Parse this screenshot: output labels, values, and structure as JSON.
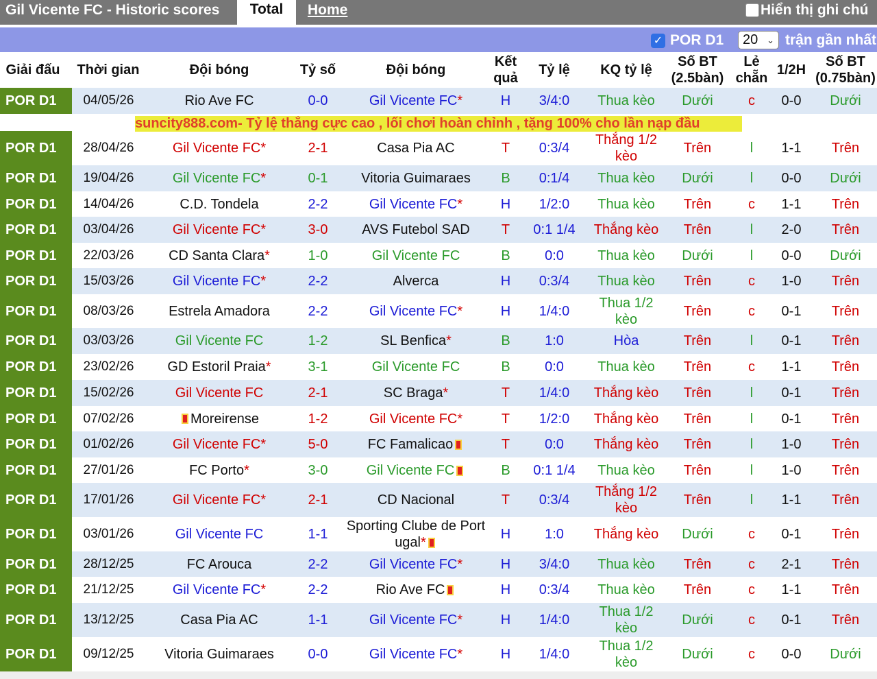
{
  "header": {
    "title": "Gil Vicente FC - Historic scores",
    "tab_total": "Total",
    "tab_home": "Home",
    "show_notes_label": "Hiển thị ghi chú"
  },
  "filter": {
    "league": "POR D1",
    "count": "20",
    "suffix": "trận gần nhất"
  },
  "columns": {
    "league": "Giải đấu",
    "time": "Thời gian",
    "home": "Đội bóng",
    "score": "Tỷ số",
    "away": "Đội bóng",
    "result": "Kết quả",
    "odds": "Tỷ lệ",
    "odds_result": "KQ tỷ lệ",
    "goals25": "Số BT (2.5bàn)",
    "oddeven": "Lẻ chẵn",
    "half": "1/2H",
    "goals075": "Số BT (0.75bàn)"
  },
  "ad_text": "suncity888.com- Tỷ lệ thắng cực cao , lối chơi hoàn chỉnh , tặng 100% cho lần nạp đầu",
  "colors": {
    "league_bg": "#5a8b1e",
    "row_alt": "#dde8f5",
    "win": "#d00000",
    "draw": "#1b1bd6",
    "loss": "#2a9a2a",
    "ad_bg": "#ecec3a",
    "ad_text": "#e0402a"
  },
  "matches": [
    {
      "league": "POR D1",
      "date": "04/05/26",
      "home": "Rio Ave FC",
      "home_star": "",
      "home_card": "",
      "home_card_before": "",
      "score_h": "0",
      "score_a": "0",
      "away": "Gil Vicente FC",
      "away_star": "*",
      "away_card": "",
      "result": "H",
      "odds": "3/4:0",
      "odds_result": "Thua kèo",
      "ou": "Dưới",
      "oe": "c",
      "half": "0-0",
      "ou2": "Dưới"
    },
    {
      "league": "POR D1",
      "date": "28/04/26",
      "home": "Gil Vicente FC",
      "home_star": "*",
      "home_card": "",
      "home_card_before": "",
      "score_h": "2",
      "score_a": "1",
      "away": "Casa Pia AC",
      "away_star": "",
      "away_card": "",
      "result": "T",
      "odds": "0:3/4",
      "odds_result": "Thắng 1/2 kèo",
      "ou": "Trên",
      "oe": "l",
      "half": "1-1",
      "ou2": "Trên"
    },
    {
      "league": "POR D1",
      "date": "19/04/26",
      "home": "Gil Vicente FC",
      "home_star": "*",
      "home_card": "",
      "home_card_before": "",
      "score_h": "0",
      "score_a": "1",
      "away": "Vitoria Guimaraes",
      "away_star": "",
      "away_card": "",
      "result": "B",
      "odds": "0:1/4",
      "odds_result": "Thua kèo",
      "ou": "Dưới",
      "oe": "l",
      "half": "0-0",
      "ou2": "Dưới"
    },
    {
      "league": "POR D1",
      "date": "14/04/26",
      "home": "C.D. Tondela",
      "home_star": "",
      "home_card": "",
      "home_card_before": "",
      "score_h": "2",
      "score_a": "2",
      "away": "Gil Vicente FC",
      "away_star": "*",
      "away_card": "",
      "result": "H",
      "odds": "1/2:0",
      "odds_result": "Thua kèo",
      "ou": "Trên",
      "oe": "c",
      "half": "1-1",
      "ou2": "Trên"
    },
    {
      "league": "POR D1",
      "date": "03/04/26",
      "home": "Gil Vicente FC",
      "home_star": "*",
      "home_card": "",
      "home_card_before": "",
      "score_h": "3",
      "score_a": "0",
      "away": "AVS Futebol SAD",
      "away_star": "",
      "away_card": "",
      "result": "T",
      "odds": "0:1 1/4",
      "odds_result": "Thắng kèo",
      "ou": "Trên",
      "oe": "l",
      "half": "2-0",
      "ou2": "Trên"
    },
    {
      "league": "POR D1",
      "date": "22/03/26",
      "home": "CD Santa Clara",
      "home_star": "*",
      "home_card": "",
      "home_card_before": "",
      "score_h": "1",
      "score_a": "0",
      "away": "Gil Vicente FC",
      "away_star": "",
      "away_card": "",
      "result": "B",
      "odds": "0:0",
      "odds_result": "Thua kèo",
      "ou": "Dưới",
      "oe": "l",
      "half": "0-0",
      "ou2": "Dưới"
    },
    {
      "league": "POR D1",
      "date": "15/03/26",
      "home": "Gil Vicente FC",
      "home_star": "*",
      "home_card": "",
      "home_card_before": "",
      "score_h": "2",
      "score_a": "2",
      "away": "Alverca",
      "away_star": "",
      "away_card": "",
      "result": "H",
      "odds": "0:3/4",
      "odds_result": "Thua kèo",
      "ou": "Trên",
      "oe": "c",
      "half": "1-0",
      "ou2": "Trên"
    },
    {
      "league": "POR D1",
      "date": "08/03/26",
      "home": "Estrela Amadora",
      "home_star": "",
      "home_card": "",
      "home_card_before": "",
      "score_h": "2",
      "score_a": "2",
      "away": "Gil Vicente FC",
      "away_star": "*",
      "away_card": "",
      "result": "H",
      "odds": "1/4:0",
      "odds_result": "Thua 1/2 kèo",
      "ou": "Trên",
      "oe": "c",
      "half": "0-1",
      "ou2": "Trên"
    },
    {
      "league": "POR D1",
      "date": "03/03/26",
      "home": "Gil Vicente FC",
      "home_star": "",
      "home_card": "",
      "home_card_before": "",
      "score_h": "1",
      "score_a": "2",
      "away": "SL Benfica",
      "away_star": "*",
      "away_card": "",
      "result": "B",
      "odds": "1:0",
      "odds_result": "Hòa",
      "ou": "Trên",
      "oe": "l",
      "half": "0-1",
      "ou2": "Trên"
    },
    {
      "league": "POR D1",
      "date": "23/02/26",
      "home": "GD Estoril Praia",
      "home_star": "*",
      "home_card": "",
      "home_card_before": "",
      "score_h": "3",
      "score_a": "1",
      "away": "Gil Vicente FC",
      "away_star": "",
      "away_card": "",
      "result": "B",
      "odds": "0:0",
      "odds_result": "Thua kèo",
      "ou": "Trên",
      "oe": "c",
      "half": "1-1",
      "ou2": "Trên"
    },
    {
      "league": "POR D1",
      "date": "15/02/26",
      "home": "Gil Vicente FC",
      "home_star": "",
      "home_card": "",
      "home_card_before": "",
      "score_h": "2",
      "score_a": "1",
      "away": "SC Braga",
      "away_star": "*",
      "away_card": "",
      "result": "T",
      "odds": "1/4:0",
      "odds_result": "Thắng kèo",
      "ou": "Trên",
      "oe": "l",
      "half": "0-1",
      "ou2": "Trên"
    },
    {
      "league": "POR D1",
      "date": "07/02/26",
      "home": "Moreirense",
      "home_star": "",
      "home_card": "",
      "home_card_before": "1",
      "score_h": "1",
      "score_a": "2",
      "away": "Gil Vicente FC",
      "away_star": "*",
      "away_card": "",
      "result": "T",
      "odds": "1/2:0",
      "odds_result": "Thắng kèo",
      "ou": "Trên",
      "oe": "l",
      "half": "0-1",
      "ou2": "Trên"
    },
    {
      "league": "POR D1",
      "date": "01/02/26",
      "home": "Gil Vicente FC",
      "home_star": "*",
      "home_card": "",
      "home_card_before": "",
      "score_h": "5",
      "score_a": "0",
      "away": "FC Famalicao",
      "away_star": "",
      "away_card": "1",
      "result": "T",
      "odds": "0:0",
      "odds_result": "Thắng kèo",
      "ou": "Trên",
      "oe": "l",
      "half": "1-0",
      "ou2": "Trên"
    },
    {
      "league": "POR D1",
      "date": "27/01/26",
      "home": "FC Porto",
      "home_star": "*",
      "home_card": "",
      "home_card_before": "",
      "score_h": "3",
      "score_a": "0",
      "away": "Gil Vicente FC",
      "away_star": "",
      "away_card": "1",
      "result": "B",
      "odds": "0:1 1/4",
      "odds_result": "Thua kèo",
      "ou": "Trên",
      "oe": "l",
      "half": "1-0",
      "ou2": "Trên"
    },
    {
      "league": "POR D1",
      "date": "17/01/26",
      "home": "Gil Vicente FC",
      "home_star": "*",
      "home_card": "",
      "home_card_before": "",
      "score_h": "2",
      "score_a": "1",
      "away": "CD Nacional",
      "away_star": "",
      "away_card": "",
      "result": "T",
      "odds": "0:3/4",
      "odds_result": "Thắng 1/2 kèo",
      "ou": "Trên",
      "oe": "l",
      "half": "1-1",
      "ou2": "Trên"
    },
    {
      "league": "POR D1",
      "date": "03/01/26",
      "home": "Gil Vicente FC",
      "home_star": "",
      "home_card": "",
      "home_card_before": "",
      "score_h": "1",
      "score_a": "1",
      "away": "Sporting Clube de Portugal",
      "away_star": "*",
      "away_card": "1",
      "result": "H",
      "odds": "1:0",
      "odds_result": "Thắng kèo",
      "ou": "Dưới",
      "oe": "c",
      "half": "0-1",
      "ou2": "Trên"
    },
    {
      "league": "POR D1",
      "date": "28/12/25",
      "home": "FC Arouca",
      "home_star": "",
      "home_card": "",
      "home_card_before": "",
      "score_h": "2",
      "score_a": "2",
      "away": "Gil Vicente FC",
      "away_star": "*",
      "away_card": "",
      "result": "H",
      "odds": "3/4:0",
      "odds_result": "Thua kèo",
      "ou": "Trên",
      "oe": "c",
      "half": "2-1",
      "ou2": "Trên"
    },
    {
      "league": "POR D1",
      "date": "21/12/25",
      "home": "Gil Vicente FC",
      "home_star": "*",
      "home_card": "",
      "home_card_before": "",
      "score_h": "2",
      "score_a": "2",
      "away": "Rio Ave FC",
      "away_star": "",
      "away_card": "1",
      "result": "H",
      "odds": "0:3/4",
      "odds_result": "Thua kèo",
      "ou": "Trên",
      "oe": "c",
      "half": "1-1",
      "ou2": "Trên"
    },
    {
      "league": "POR D1",
      "date": "13/12/25",
      "home": "Casa Pia AC",
      "home_star": "",
      "home_card": "",
      "home_card_before": "",
      "score_h": "1",
      "score_a": "1",
      "away": "Gil Vicente FC",
      "away_star": "*",
      "away_card": "",
      "result": "H",
      "odds": "1/4:0",
      "odds_result": "Thua 1/2 kèo",
      "ou": "Dưới",
      "oe": "c",
      "half": "0-1",
      "ou2": "Trên"
    },
    {
      "league": "POR D1",
      "date": "09/12/25",
      "home": "Vitoria Guimaraes",
      "home_star": "",
      "home_card": "",
      "home_card_before": "",
      "score_h": "0",
      "score_a": "0",
      "away": "Gil Vicente FC",
      "away_star": "*",
      "away_card": "",
      "result": "H",
      "odds": "1/4:0",
      "odds_result": "Thua 1/2 kèo",
      "ou": "Dưới",
      "oe": "c",
      "half": "0-0",
      "ou2": "Dưới"
    }
  ]
}
